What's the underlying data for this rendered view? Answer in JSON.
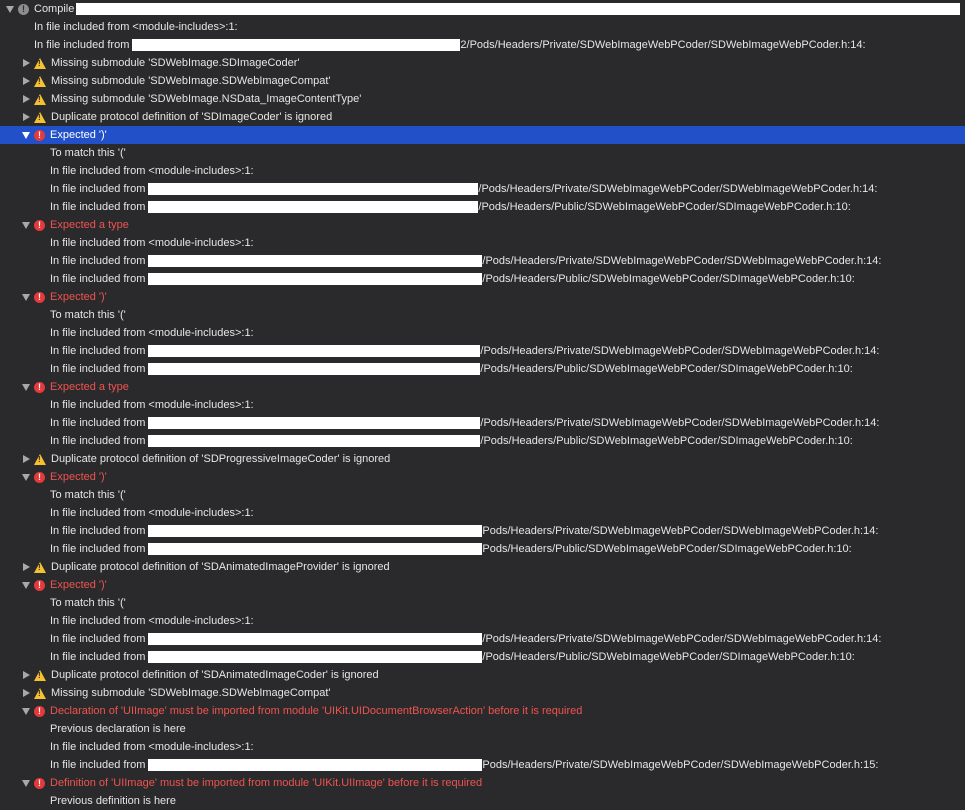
{
  "compile_header": {
    "label": "Compile"
  },
  "issues": [
    {
      "kind": "detail",
      "indent": 1,
      "text": "In file included from <module-includes>:1:"
    },
    {
      "kind": "detail",
      "indent": 1,
      "text": "In file included from",
      "redacted": true,
      "suffix": "2/Pods/Headers/Private/SDWebImageWebPCoder/SDWebImageWebPCoder.h:14:"
    },
    {
      "kind": "issue",
      "severity": "warning",
      "expanded": false,
      "text": "Missing submodule 'SDWebImage.SDImageCoder'"
    },
    {
      "kind": "issue",
      "severity": "warning",
      "expanded": false,
      "text": "Missing submodule 'SDWebImage.SDWebImageCompat'"
    },
    {
      "kind": "issue",
      "severity": "warning",
      "expanded": false,
      "text": "Missing submodule 'SDWebImage.NSData_ImageContentType'"
    },
    {
      "kind": "issue",
      "severity": "warning",
      "expanded": false,
      "text": "Duplicate protocol definition of 'SDImageCoder' is ignored"
    },
    {
      "kind": "issue",
      "severity": "error",
      "expanded": true,
      "selected": true,
      "text": "Expected ')'"
    },
    {
      "kind": "detail",
      "indent": 2,
      "text": "To match this '('"
    },
    {
      "kind": "detail",
      "indent": 2,
      "text": "In file included from <module-includes>:1:"
    },
    {
      "kind": "detail",
      "indent": 2,
      "text": "In file included from",
      "redacted": true,
      "suffix": "/Pods/Headers/Private/SDWebImageWebPCoder/SDWebImageWebPCoder.h:14:"
    },
    {
      "kind": "detail",
      "indent": 2,
      "text": "In file included from",
      "redacted": true,
      "suffix": "/Pods/Headers/Public/SDWebImageWebPCoder/SDImageWebPCoder.h:10:"
    },
    {
      "kind": "issue",
      "severity": "error",
      "expanded": true,
      "text": "Expected a type"
    },
    {
      "kind": "detail",
      "indent": 2,
      "text": "In file included from <module-includes>:1:"
    },
    {
      "kind": "detail",
      "indent": 2,
      "text": "In file included from",
      "redacted": true,
      "suffix": "/Pods/Headers/Private/SDWebImageWebPCoder/SDWebImageWebPCoder.h:14:"
    },
    {
      "kind": "detail",
      "indent": 2,
      "text": "In file included from",
      "redacted": true,
      "suffix": "/Pods/Headers/Public/SDWebImageWebPCoder/SDImageWebPCoder.h:10:"
    },
    {
      "kind": "issue",
      "severity": "error",
      "expanded": true,
      "text": "Expected ')'"
    },
    {
      "kind": "detail",
      "indent": 2,
      "text": "To match this '('"
    },
    {
      "kind": "detail",
      "indent": 2,
      "text": "In file included from <module-includes>:1:"
    },
    {
      "kind": "detail",
      "indent": 2,
      "text": "In file included from",
      "redacted": true,
      "suffix": "/Pods/Headers/Private/SDWebImageWebPCoder/SDWebImageWebPCoder.h:14:"
    },
    {
      "kind": "detail",
      "indent": 2,
      "text": "In file included from",
      "redacted": true,
      "suffix": "/Pods/Headers/Public/SDWebImageWebPCoder/SDImageWebPCoder.h:10:"
    },
    {
      "kind": "issue",
      "severity": "error",
      "expanded": true,
      "text": "Expected a type"
    },
    {
      "kind": "detail",
      "indent": 2,
      "text": "In file included from <module-includes>:1:"
    },
    {
      "kind": "detail",
      "indent": 2,
      "text": "In file included from",
      "redacted": true,
      "suffix": "/Pods/Headers/Private/SDWebImageWebPCoder/SDWebImageWebPCoder.h:14:"
    },
    {
      "kind": "detail",
      "indent": 2,
      "text": "In file included from",
      "redacted": true,
      "suffix": "/Pods/Headers/Public/SDWebImageWebPCoder/SDImageWebPCoder.h:10:"
    },
    {
      "kind": "issue",
      "severity": "warning",
      "expanded": false,
      "text": "Duplicate protocol definition of 'SDProgressiveImageCoder' is ignored"
    },
    {
      "kind": "issue",
      "severity": "error",
      "expanded": true,
      "text": "Expected ')'"
    },
    {
      "kind": "detail",
      "indent": 2,
      "text": "To match this '('"
    },
    {
      "kind": "detail",
      "indent": 2,
      "text": "In file included from <module-includes>:1:"
    },
    {
      "kind": "detail",
      "indent": 2,
      "text": "In file included from",
      "redacted": true,
      "suffix": "Pods/Headers/Private/SDWebImageWebPCoder/SDWebImageWebPCoder.h:14:"
    },
    {
      "kind": "detail",
      "indent": 2,
      "text": "In file included from",
      "redacted": true,
      "suffix": "Pods/Headers/Public/SDWebImageWebPCoder/SDImageWebPCoder.h:10:"
    },
    {
      "kind": "issue",
      "severity": "warning",
      "expanded": false,
      "text": "Duplicate protocol definition of 'SDAnimatedImageProvider' is ignored"
    },
    {
      "kind": "issue",
      "severity": "error",
      "expanded": true,
      "text": "Expected ')'"
    },
    {
      "kind": "detail",
      "indent": 2,
      "text": "To match this '('"
    },
    {
      "kind": "detail",
      "indent": 2,
      "text": "In file included from <module-includes>:1:"
    },
    {
      "kind": "detail",
      "indent": 2,
      "text": "In file included from",
      "redacted": true,
      "suffix": "/Pods/Headers/Private/SDWebImageWebPCoder/SDWebImageWebPCoder.h:14:"
    },
    {
      "kind": "detail",
      "indent": 2,
      "text": "In file included from",
      "redacted": true,
      "suffix": "/Pods/Headers/Public/SDWebImageWebPCoder/SDImageWebPCoder.h:10:"
    },
    {
      "kind": "issue",
      "severity": "warning",
      "expanded": false,
      "text": "Duplicate protocol definition of 'SDAnimatedImageCoder' is ignored"
    },
    {
      "kind": "issue",
      "severity": "warning",
      "expanded": false,
      "text": "Missing submodule 'SDWebImage.SDWebImageCompat'"
    },
    {
      "kind": "issue",
      "severity": "error",
      "expanded": true,
      "text": "Declaration of 'UIImage' must be imported from module 'UIKit.UIDocumentBrowserAction' before it is required"
    },
    {
      "kind": "detail",
      "indent": 2,
      "text": "Previous declaration is here"
    },
    {
      "kind": "detail",
      "indent": 2,
      "text": "In file included from <module-includes>:1:"
    },
    {
      "kind": "detail",
      "indent": 2,
      "text": "In file included from",
      "redacted": true,
      "suffix": "Pods/Headers/Private/SDWebImageWebPCoder/SDWebImageWebPCoder.h:15:"
    },
    {
      "kind": "issue",
      "severity": "error",
      "expanded": true,
      "text": "Definition of 'UIImage' must be imported from module 'UIKit.UIImage' before it is required"
    },
    {
      "kind": "detail",
      "indent": 2,
      "text": "Previous definition is here"
    }
  ]
}
